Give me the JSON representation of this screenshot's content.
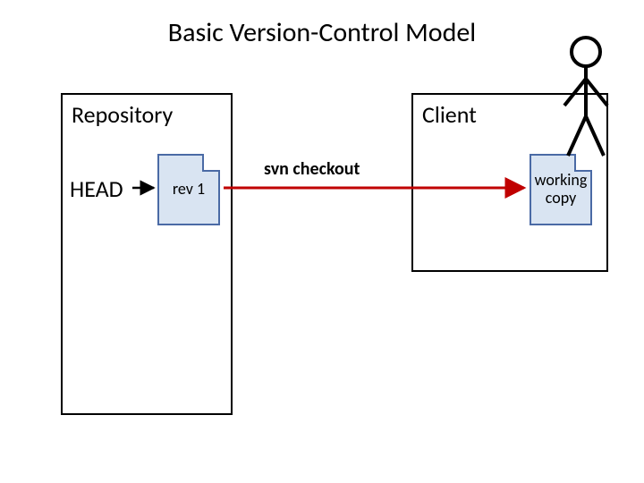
{
  "title": "Basic Version-Control Model",
  "repository": {
    "label": "Repository",
    "head_label": "HEAD",
    "rev_label": "rev 1"
  },
  "client": {
    "label": "Client",
    "working_copy_label": "working copy"
  },
  "arrows": {
    "checkout_label": "svn checkout"
  },
  "colors": {
    "checkout_arrow": "#c00000",
    "file_border": "#4a6aa5",
    "file_fill": "#d9e4f2"
  }
}
